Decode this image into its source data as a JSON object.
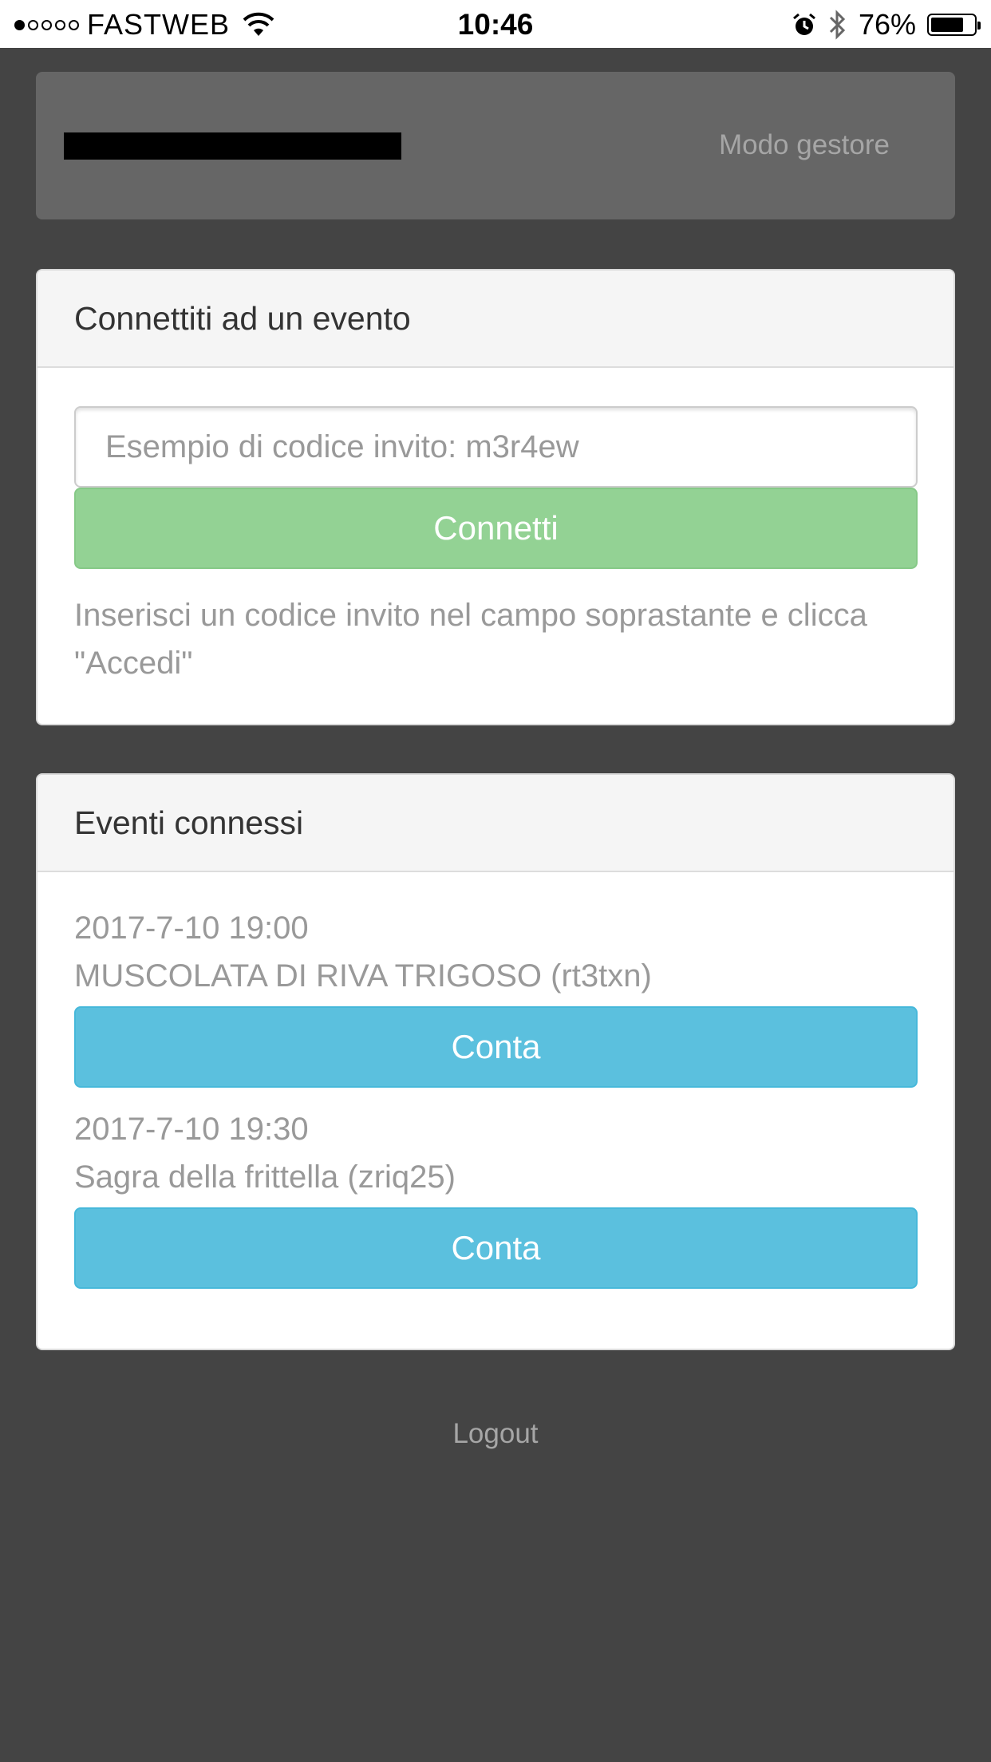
{
  "status_bar": {
    "carrier": "FASTWEB",
    "time": "10:46",
    "battery_percent": "76%",
    "battery_level": 0.76,
    "signal_bars_filled": 1,
    "signal_bars_total": 5,
    "icons": [
      "wifi-icon",
      "alarm-icon",
      "bluetooth-icon",
      "battery-icon"
    ]
  },
  "navbar": {
    "manager_mode_label": "Modo gestore"
  },
  "connect_panel": {
    "title": "Connettiti ad un evento",
    "invite_placeholder": "Esempio di codice invito: m3r4ew",
    "invite_value": "",
    "connect_label": "Connetti",
    "help_text": "Inserisci un codice invito nel campo soprastante e clicca \"Accedi\""
  },
  "events_panel": {
    "title": "Eventi connessi",
    "events": [
      {
        "date": "2017-7-10 19:00",
        "name": "MUSCOLATA DI RIVA TRIGOSO (rt3txn)",
        "button_label": "Conta"
      },
      {
        "date": "2017-7-10 19:30",
        "name": "Sagra della frittella (zriq25)",
        "button_label": "Conta"
      }
    ]
  },
  "logout_label": "Logout",
  "colors": {
    "background": "#444444",
    "navbar": "#666666",
    "connect_button": "#93d294",
    "count_button": "#5bc0de",
    "muted_text": "#999999"
  }
}
